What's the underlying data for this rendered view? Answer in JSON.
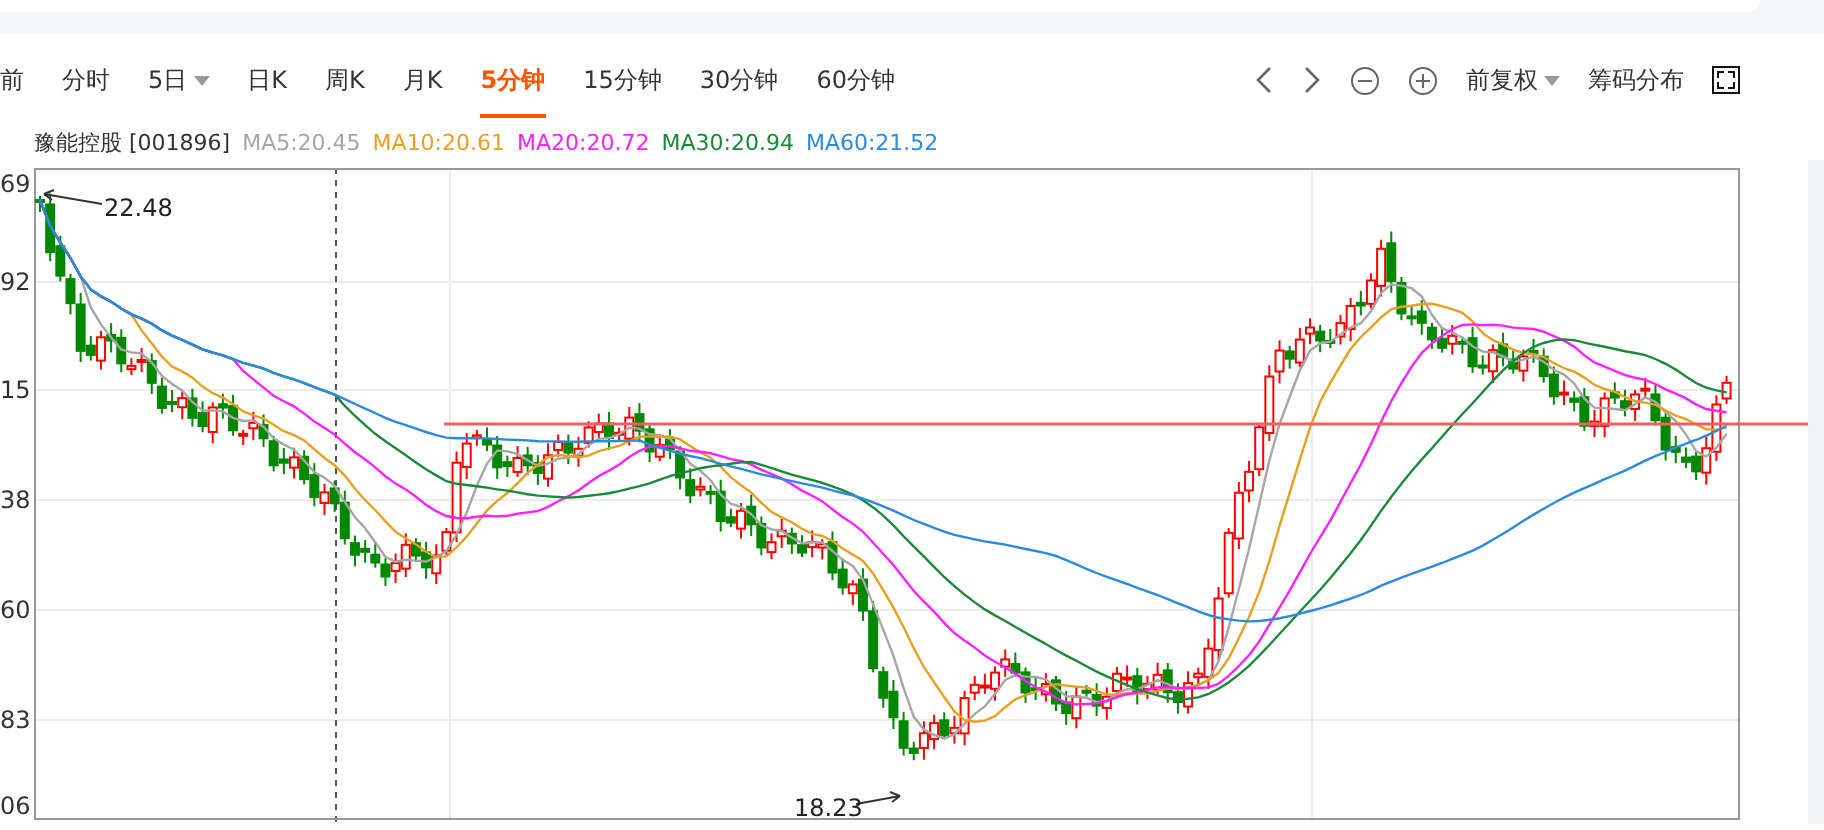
{
  "tabs": [
    {
      "label": "前",
      "kind": "tab",
      "selected": false
    },
    {
      "label": "分时",
      "kind": "tab",
      "selected": false
    },
    {
      "label": "5日",
      "kind": "dropdown",
      "selected": false
    },
    {
      "label": "日K",
      "kind": "tab",
      "selected": false
    },
    {
      "label": "周K",
      "kind": "tab",
      "selected": false
    },
    {
      "label": "月K",
      "kind": "tab",
      "selected": false
    },
    {
      "label": "5分钟",
      "kind": "tab",
      "selected": true
    },
    {
      "label": "15分钟",
      "kind": "tab",
      "selected": false
    },
    {
      "label": "30分钟",
      "kind": "tab",
      "selected": false
    },
    {
      "label": "60分钟",
      "kind": "tab",
      "selected": false
    }
  ],
  "toolbar": {
    "adjust": "前复权",
    "chips": "筹码分布"
  },
  "legend": {
    "stock": "豫能控股 [001896]",
    "averages": [
      {
        "label": "MA5:20.45",
        "color": "#a6a6a6"
      },
      {
        "label": "MA10:20.61",
        "color": "#e8a020"
      },
      {
        "label": "MA20:20.72",
        "color": "#ff20ff"
      },
      {
        "label": "MA30:20.94",
        "color": "#1a8a3a"
      },
      {
        "label": "MA60:21.52",
        "color": "#2a8ae0"
      }
    ]
  },
  "chart": {
    "y_ticks": [
      "69",
      "92",
      "15",
      "38",
      "60",
      "83",
      "06"
    ],
    "high_label": "22.48",
    "low_label": "18.23"
  }
}
